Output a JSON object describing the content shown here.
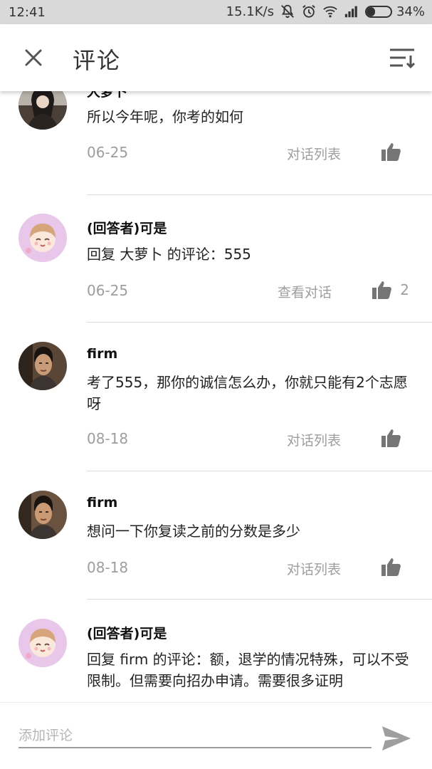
{
  "status_bar": {
    "time": "12:41",
    "net_speed": "15.1K/s",
    "battery": "34%",
    "battery_level": 0.34,
    "icons": [
      "mute-icon",
      "alarm-icon",
      "wifi-icon",
      "signal-icon",
      "battery-icon"
    ]
  },
  "header": {
    "title": "评论",
    "close_icon": "close-icon",
    "sort_icon": "sort-icon"
  },
  "comments": [
    {
      "author": "大萝卜",
      "text": "所以今年呢，你考的如何",
      "date": "06-25",
      "thread_label": "对话列表",
      "likes": "",
      "avatar": "photo-avatar"
    },
    {
      "author": "(回答者)可是",
      "text": "回复 大萝卜 的评论：555",
      "date": "06-25",
      "thread_label": "查看对话",
      "likes": "2",
      "avatar": "anime-avatar"
    },
    {
      "author": "firm",
      "text": "考了555，那你的诚信怎么办，你就只能有2个志愿呀",
      "date": "08-18",
      "thread_label": "对话列表",
      "likes": "",
      "avatar": "photo-avatar"
    },
    {
      "author": "firm",
      "text": "想问一下你复读之前的分数是多少",
      "date": "08-18",
      "thread_label": "对话列表",
      "likes": "",
      "avatar": "photo-avatar"
    },
    {
      "author": "(回答者)可是",
      "text": "回复 firm 的评论：额，退学的情况特殊，可以不受限制。但需要向招办申请。需要很多证明",
      "date": "",
      "thread_label": "",
      "likes": "",
      "avatar": "anime-avatar"
    }
  ],
  "input": {
    "placeholder": "添加评论",
    "value": "",
    "send_icon": "send-icon"
  },
  "colors": {
    "status_bar_bg": "#d9d9d9",
    "meta_text": "#9e9e9e",
    "divider": "#dcdcdc",
    "icon_gray": "#757575"
  }
}
